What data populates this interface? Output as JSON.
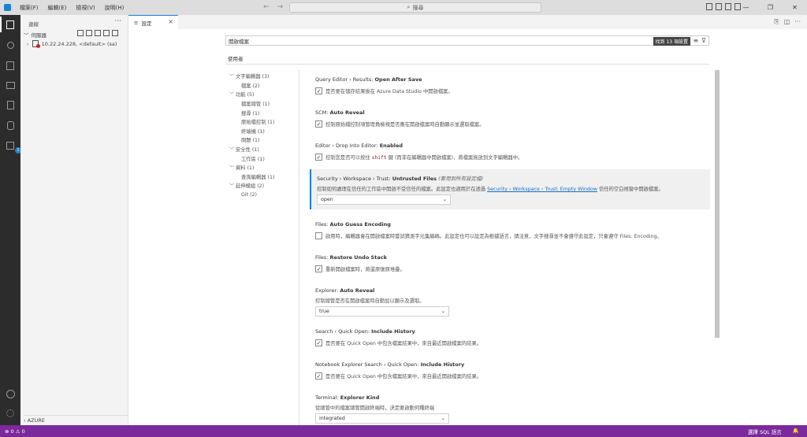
{
  "titlebar": {
    "menu": [
      "檔案(F)",
      "編輯(E)",
      "檢視(V)",
      "說明(H)"
    ],
    "search": "搜尋",
    "nav_back": "←",
    "nav_forward": "→"
  },
  "sidebar": {
    "title": "連線",
    "more": "···",
    "section": "伺服器",
    "connection": "10.22.24.228, <default> (sa)",
    "footer": "AZURE"
  },
  "tab": {
    "label": "設定",
    "close": "×"
  },
  "settings": {
    "search_value": "開啟檔案",
    "found_badge": "找到 13 項設置",
    "scope_tab": "使用者",
    "toc": [
      {
        "label": "文字編輯器 (3)",
        "level": 1,
        "chevron": "﹀"
      },
      {
        "label": "檔案 (2)",
        "level": 2
      },
      {
        "label": "功能 (5)",
        "level": 1,
        "chevron": "﹀"
      },
      {
        "label": "檔案總管 (1)",
        "level": 2
      },
      {
        "label": "搜尋 (1)",
        "level": 2
      },
      {
        "label": "原始檔控制 (1)",
        "level": 2
      },
      {
        "label": "終端機 (1)",
        "level": 2
      },
      {
        "label": "問題 (1)",
        "level": 2
      },
      {
        "label": "安全性 (1)",
        "level": 1,
        "chevron": "﹀"
      },
      {
        "label": "工作區 (1)",
        "level": 2
      },
      {
        "label": "資料 (1)",
        "level": 1,
        "chevron": "﹀"
      },
      {
        "label": "查詢編輯器 (1)",
        "level": 2
      },
      {
        "label": "延伸模組 (2)",
        "level": 1,
        "chevron": "﹀"
      },
      {
        "label": "Git (2)",
        "level": 2
      }
    ],
    "items": [
      {
        "cat": "Query Editor › Results: ",
        "name": "Open After Save",
        "desc": "是否要在儲存結果後在 Azure Data Studio 中開啟檔案。",
        "type": "checkbox",
        "checked": true
      },
      {
        "cat": "SCM: ",
        "name": "Auto Reveal",
        "desc": "控制原始檔控制項管理員檢視是否應在開啟檔案時自動顯示並選取檔案。",
        "type": "checkbox",
        "checked": true
      },
      {
        "cat": "Editor › Drop Into Editor: ",
        "name": "Enabled",
        "desc_pre": "控制您是否可以按住 ",
        "desc_code": "shift",
        "desc_post": " 鍵 (而非在編輯器中開啟檔案)，將檔案拖放到文字編輯器中。",
        "type": "checkbox",
        "checked": true
      },
      {
        "cat": "Security › Workspace › Trust: ",
        "name": "Untrusted Files",
        "note": "(套用到所有設定檔)",
        "desc_pre": "控制如何處理在信任的工作區中開啟不受信任的檔案。此設定也適用於在透過 ",
        "desc_link": "Security › Workspace › Trust: Empty Window",
        "desc_post": " 信任的空白視窗中開啟檔案。",
        "type": "select",
        "value": "open"
      },
      {
        "cat": "Files: ",
        "name": "Auto Guess Encoding",
        "desc_pre": "啟用時，編輯器會在開啟檔案時嘗試猜測字元集編碼。此設定也可以設定為根據語言，請注意，文字搜尋並不會遵守此設定，只會遵守 ",
        "desc_link": "Files: Encoding",
        "desc_post": "。",
        "type": "checkbox",
        "checked": false
      },
      {
        "cat": "Files: ",
        "name": "Restore Undo Stack",
        "desc": "重新開啟檔案時，將還原復原堆疊。",
        "type": "checkbox",
        "checked": true
      },
      {
        "cat": "Explorer: ",
        "name": "Auto Reveal",
        "desc": "控制總管是否在開啟檔案時自動加以顯示及選取。",
        "type": "select",
        "value": "true"
      },
      {
        "cat": "Search › Quick Open: ",
        "name": "Include History",
        "desc": "是否要在 Quick Open 中包含檔案結果中，來自最近開啟檔案的結果。",
        "type": "checkbox",
        "checked": true
      },
      {
        "cat": "Notebook Explorer Search › Quick Open: ",
        "name": "Include History",
        "desc": "是否要在 Quick Open 中包含檔案結果中，來自最近開啟檔案的結果。",
        "type": "checkbox",
        "checked": true
      },
      {
        "cat": "Terminal: ",
        "name": "Explorer Kind",
        "desc": "從總管中的檔案總管開啟終端時，決定要啟動何種終端",
        "type": "select",
        "value": "integrated"
      }
    ]
  },
  "statusbar": {
    "problems": "⊗ 0 ⚠ 0",
    "language": "選擇 SQL 語言",
    "bell": "🔔"
  },
  "colors": {
    "accent": "#1a7fd6",
    "statusbar": "#7a2a9a",
    "activitybar": "#2c2c2c"
  }
}
